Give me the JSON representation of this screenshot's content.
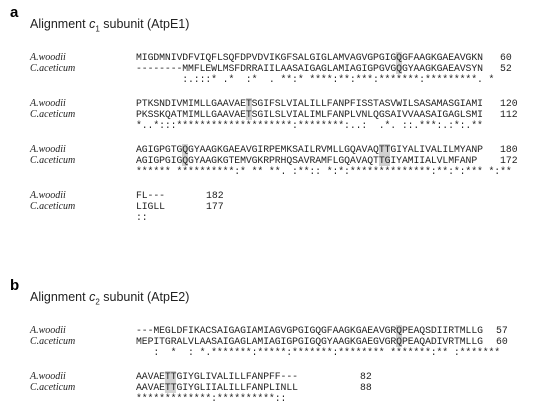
{
  "panels": [
    {
      "label": "a",
      "title_prefix": "Alignment ",
      "title_var": "c",
      "title_sub": "1",
      "title_suffix": " subunit (AtpE1)",
      "blocks": [
        {
          "rows": [
            {
              "species": "A.woodii",
              "seq": "MIGDMNIVDFVIQFLSQFDPVDVIKGFSALGIGLAMVAGVGPGIGQGFAAGKGAEAVGKN",
              "num": "60"
            },
            {
              "species": "C.aceticum",
              "seq": "--------MMFLEWLMSFDRRAIILAASAIGAGLAMIAGIGPGVGQGYAAGKGAEAVSYN",
              "num": "52"
            },
            {
              "species": "",
              "seq": "        :.:::* .*  :*  . **:* ****:**:***:*******:*********. *",
              "num": ""
            }
          ]
        },
        {
          "rows": [
            {
              "species": "A.woodii",
              "seq": "PTKSNDIVMIMLLGAAVAETSGIFSLVIALILLFANPFISSTASVWILSASAMASGIAMI",
              "num": "120"
            },
            {
              "species": "C.aceticum",
              "seq": "PKSSKQATMIMLLGAAVAETSGILSLVIALIMLFANPLVNLQGSAIVVAASAIGAGLSMI",
              "num": "112"
            },
            {
              "species": "",
              "seq": "*..*:::********************:********:..:  .*. ::.***:.:*:.**",
              "num": ""
            }
          ]
        },
        {
          "rows": [
            {
              "species": "A.woodii",
              "seq": "AGIGPGTGQGYAAGKGAEAVGIRPEMKSAILRVMLLGQAVAQTTGIYALIVALILMYANP",
              "num": "180"
            },
            {
              "species": "C.aceticum",
              "seq": "AGIGPGIGQGYAAGKGTEMVGKRPRHQSAVRAMFLGQAVAQTTGIYAMIIALVLMFANP",
              "num": "172"
            },
            {
              "species": "",
              "seq": "****** **********:* ** **. :**:: *:*:**************:**:*:*** *:**",
              "num": ""
            }
          ]
        },
        {
          "rows": [
            {
              "species": "A.woodii",
              "seq": "FL---",
              "num": "182"
            },
            {
              "species": "C.aceticum",
              "seq": "LIGLL",
              "num": "177"
            },
            {
              "species": "",
              "seq": "::",
              "num": ""
            }
          ]
        }
      ]
    },
    {
      "label": "b",
      "title_prefix": "Alignment ",
      "title_var": "c",
      "title_sub": "2",
      "title_suffix": " subunit (AtpE2)",
      "blocks": [
        {
          "rows": [
            {
              "species": "A.woodii",
              "seq": "---MEGLDFIKACSAIGAGIAMIAGVGPGIGQGFAAGKGAEAVGRQPEAQSDIIRTMLLG",
              "num": "57"
            },
            {
              "species": "C.aceticum",
              "seq": "MEPITGRALVLAASAIGAGLAMIAGIGPGIGQGYAAGKGAEGVGRQPEAQADIVRTMLLG",
              "num": "60"
            },
            {
              "species": "",
              "seq": "   :  *  : *.*******:*****:*******:******** *******:** :*******",
              "num": ""
            }
          ]
        },
        {
          "rows": [
            {
              "species": "A.woodii",
              "seq": "AAVAETTGIYGLIVALILLFANPFF---",
              "num": "82"
            },
            {
              "species": "C.aceticum",
              "seq": "AAVAETTGIYGLIIALILLFANPLINLL",
              "num": "88"
            },
            {
              "species": "",
              "seq": "*************:**********::",
              "num": ""
            }
          ]
        }
      ]
    }
  ],
  "highlight_color": "#d2d2d2"
}
